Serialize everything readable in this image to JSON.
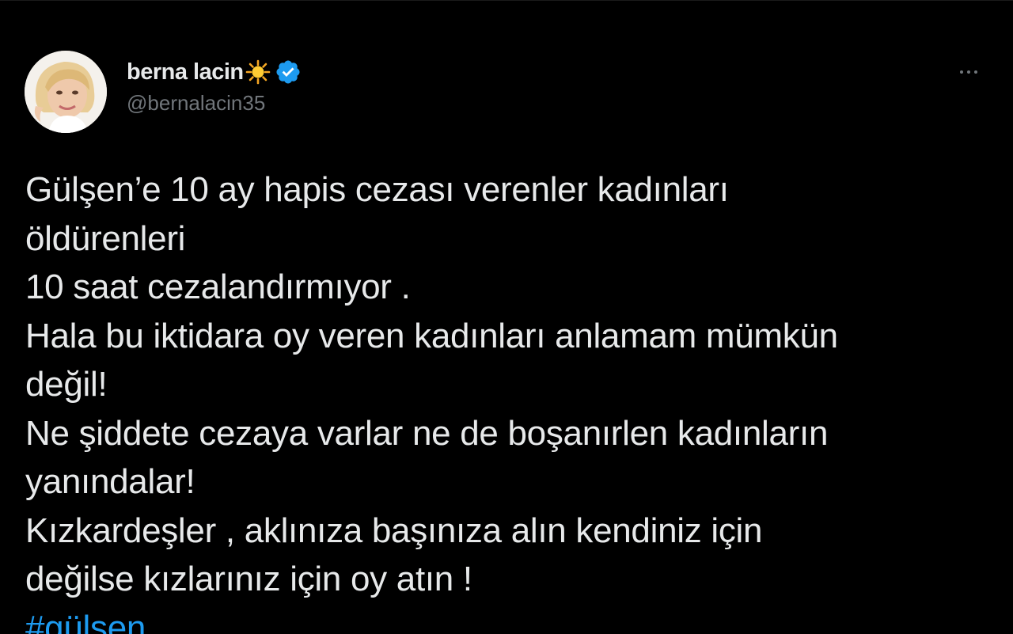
{
  "tweet": {
    "author": {
      "display_name": "berna lacin",
      "handle": "@bernalacin35",
      "name_emoji": "sun-icon",
      "verified": true
    },
    "more_label": "···",
    "text_lines": [
      "Gülşen’e 10 ay hapis cezası verenler kadınları",
      "öldürenleri",
      "10 saat cezalandırmıyor .",
      "Hala bu iktidara oy veren kadınları anlamam mümkün",
      "değil!",
      "Ne şiddete cezaya varlar ne de boşanırlen kadınların",
      "yanındalar!",
      "Kızkardeşler , aklınıza başınıza alın kendiniz için",
      "değilse kızlarınız için oy atın !"
    ],
    "hashtag": "#gülşen"
  },
  "colors": {
    "background": "#000000",
    "text": "#e7e9ea",
    "secondary": "#71767b",
    "link": "#1d9bf0",
    "verified": "#1d9bf0"
  }
}
